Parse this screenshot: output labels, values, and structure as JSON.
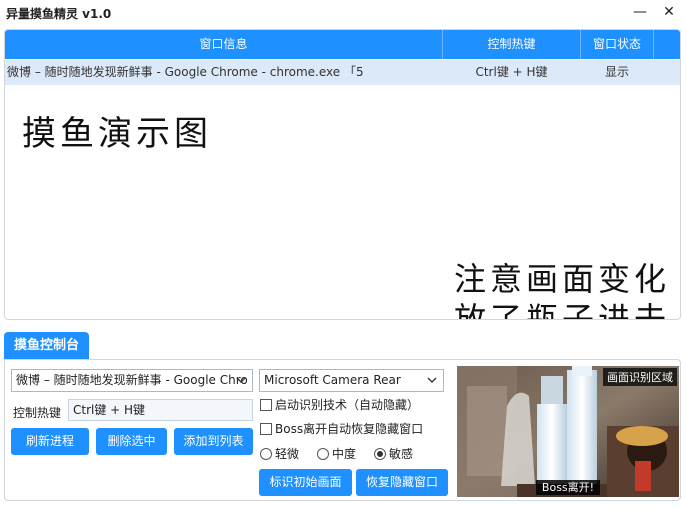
{
  "window": {
    "title": "异量摸鱼精灵 v1.0",
    "minimize_glyph": "—",
    "close_glyph": "✕"
  },
  "table": {
    "headers": [
      "窗口信息",
      "控制热键",
      "窗口状态"
    ],
    "rows": [
      {
        "window_info": "微博 – 随时随地发现新鲜事 - Google Chrome - chrome.exe 「5",
        "hotkey": "Ctrl键 + H键",
        "status": "显示"
      }
    ]
  },
  "demo": {
    "title": "摸鱼演示图",
    "note_line1": "注意画面变化",
    "note_line2": "放了瓶子进去"
  },
  "console": {
    "tab_label": "摸鱼控制台",
    "window_select_value": "微博 – 随时随地发现新鲜事 - Google Chro",
    "hotkey_label": "控制热键",
    "hotkey_value": "Ctrl键 + H键",
    "refresh_button": "刷新进程",
    "delete_button": "删除选中",
    "add_button": "添加到列表",
    "camera_select_value": "Microsoft Camera Rear",
    "auto_detect_checkbox": "启动识别技术（自动隐藏）",
    "auto_detect_checked": false,
    "boss_leave_checkbox": "Boss离开自动恢复隐藏窗口",
    "boss_leave_checked": false,
    "sensitivity_options": [
      "轻微",
      "中度",
      "敏感"
    ],
    "sensitivity_selected": "敏感",
    "mark_button": "标识初始画面",
    "restore_button": "恢复隐藏窗口",
    "preview_label": "画面识别区域",
    "preview_status": "Boss离开!"
  },
  "colors": {
    "accent": "#1e90ff",
    "row_highlight": "#dce9f8"
  }
}
